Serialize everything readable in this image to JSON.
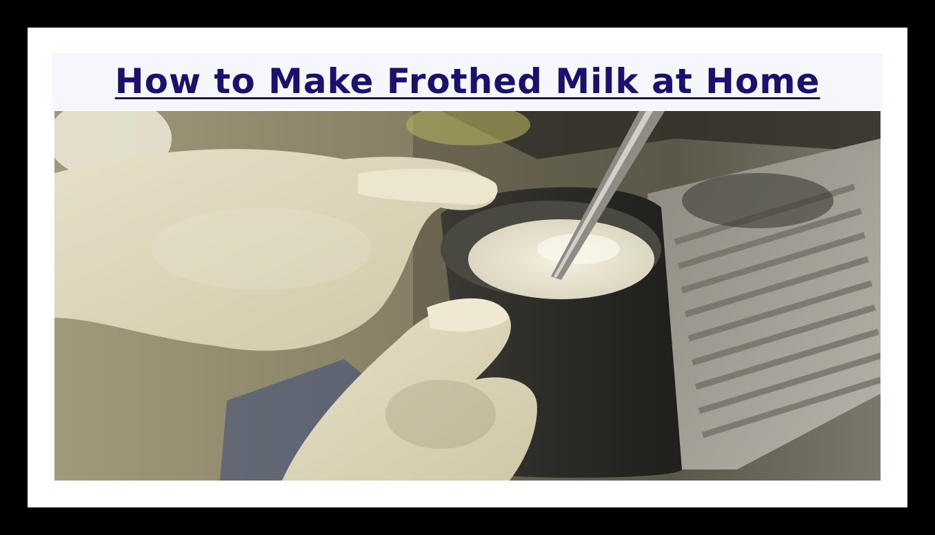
{
  "article": {
    "title": "How to Make Frothed Milk at Home"
  },
  "image": {
    "subject": "milk-frothing-photo"
  },
  "colors": {
    "frame": "#000000",
    "card": "#ffffff",
    "title_bg": "#f6f6fd",
    "title_text": "#1a1070"
  }
}
